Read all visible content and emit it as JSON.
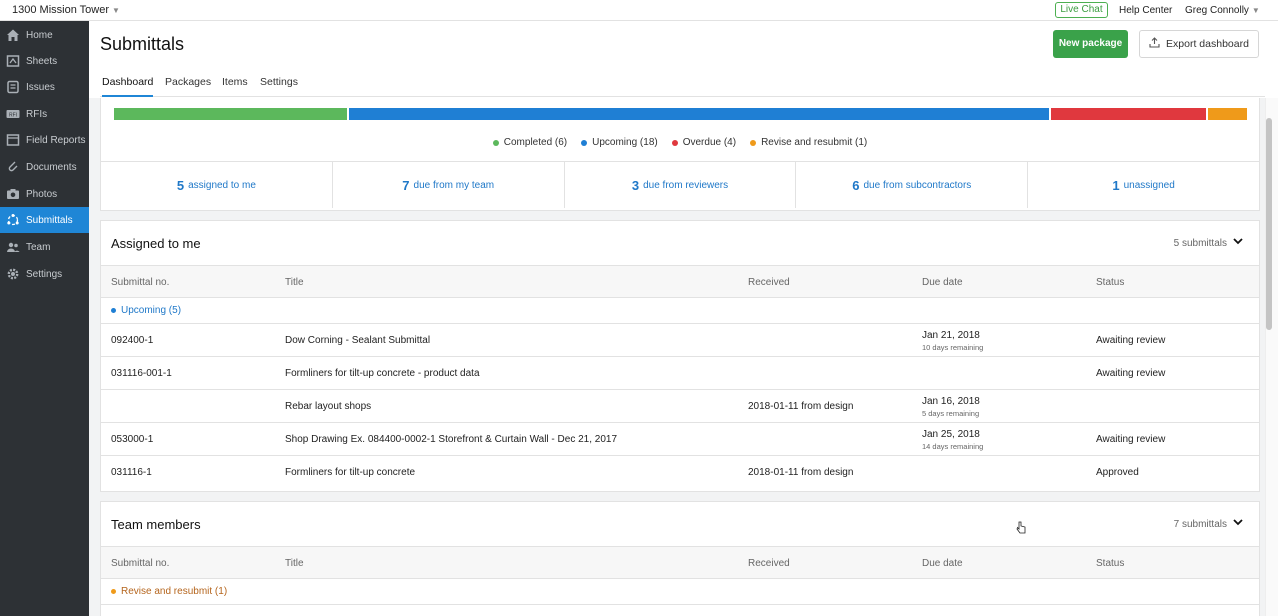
{
  "topbar": {
    "project": "1300 Mission Tower",
    "live_chat": "Live Chat",
    "help_center": "Help Center",
    "user": "Greg Connolly"
  },
  "sidebar": {
    "items": [
      {
        "label": "Home",
        "icon": "home-icon"
      },
      {
        "label": "Sheets",
        "icon": "sheets-icon"
      },
      {
        "label": "Issues",
        "icon": "issues-icon"
      },
      {
        "label": "RFIs",
        "icon": "rfi-icon"
      },
      {
        "label": "Field Reports",
        "icon": "field-reports-icon"
      },
      {
        "label": "Documents",
        "icon": "documents-icon"
      },
      {
        "label": "Photos",
        "icon": "camera-icon"
      },
      {
        "label": "Submittals",
        "icon": "submittals-icon"
      },
      {
        "label": "Team",
        "icon": "team-icon"
      },
      {
        "label": "Settings",
        "icon": "gear-icon"
      }
    ],
    "active": "Submittals"
  },
  "header": {
    "title": "Submittals",
    "new_package": "New package",
    "export_dashboard": "Export dashboard"
  },
  "tabs": [
    "Dashboard",
    "Packages",
    "Items",
    "Settings"
  ],
  "status_bar": {
    "segments": [
      {
        "label": "Completed",
        "count": 6,
        "color": "#5cb85c"
      },
      {
        "label": "Upcoming",
        "count": 18,
        "color": "#1f7fd4"
      },
      {
        "label": "Overdue",
        "count": 4,
        "color": "#e0383e"
      },
      {
        "label": "Revise and resubmit",
        "count": 1,
        "color": "#ef9a1a"
      }
    ],
    "legend": [
      "Completed (6)",
      "Upcoming (18)",
      "Overdue (4)",
      "Revise and resubmit (1)"
    ]
  },
  "stats": [
    {
      "num": "5",
      "label": "assigned to me"
    },
    {
      "num": "7",
      "label": "due from my team"
    },
    {
      "num": "3",
      "label": "due from reviewers"
    },
    {
      "num": "6",
      "label": "due from subcontractors"
    },
    {
      "num": "1",
      "label": "unassigned"
    }
  ],
  "assigned": {
    "title": "Assigned to me",
    "count": "5 submittals",
    "columns": [
      "Submittal no.",
      "Title",
      "Received",
      "Due date",
      "Status"
    ],
    "group": "Upcoming (5)",
    "rows": [
      {
        "no": "092400-1",
        "title": "Dow Corning - Sealant Submittal",
        "received": "",
        "due": "Jan 21, 2018",
        "remaining": "10 days remaining",
        "status": "Awaiting review"
      },
      {
        "no": "031116-001-1",
        "title": "Formliners for tilt-up concrete - product data",
        "received": "",
        "due": "",
        "remaining": "",
        "status": "Awaiting review"
      },
      {
        "no": "",
        "title": "Rebar layout shops",
        "received": "2018-01-11 from design",
        "due": "Jan 16, 2018",
        "remaining": "5 days remaining",
        "status": ""
      },
      {
        "no": "053000-1",
        "title": "Shop Drawing Ex. 084400-0002-1 Storefront & Curtain Wall - Dec 21, 2017",
        "received": "",
        "due": "Jan 25, 2018",
        "remaining": "14 days remaining",
        "status": "Awaiting review"
      },
      {
        "no": "031116-1",
        "title": "Formliners for tilt-up concrete",
        "received": "2018-01-11 from design",
        "due": "",
        "remaining": "",
        "status": "Approved"
      }
    ]
  },
  "team": {
    "title": "Team members",
    "count": "7 submittals",
    "columns": [
      "Submittal no.",
      "Title",
      "Received",
      "Due date",
      "Status"
    ],
    "group": "Revise and resubmit (1)"
  }
}
